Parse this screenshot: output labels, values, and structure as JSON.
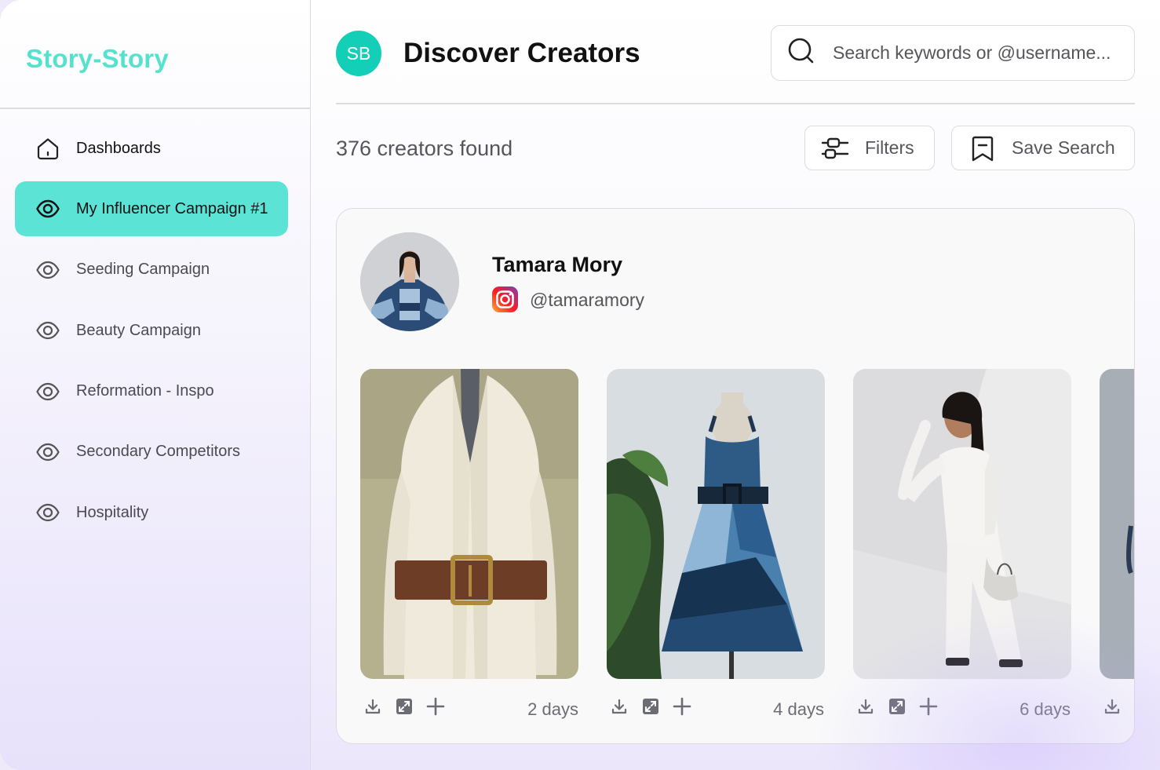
{
  "sidebar": {
    "logo": "Story-Story",
    "items": [
      {
        "label": "Dashboards",
        "icon": "home-icon"
      },
      {
        "label": "My Influencer Campaign #1",
        "icon": "eye-icon",
        "active": true
      },
      {
        "label": "Seeding Campaign",
        "icon": "eye-icon"
      },
      {
        "label": "Beauty Campaign",
        "icon": "eye-icon"
      },
      {
        "label": "Reformation - Inspo",
        "icon": "eye-icon"
      },
      {
        "label": "Secondary Competitors",
        "icon": "eye-icon"
      },
      {
        "label": "Hospitality",
        "icon": "eye-icon"
      }
    ]
  },
  "header": {
    "avatar_initials": "SB",
    "title": "Discover Creators",
    "search_placeholder": "Search keywords or @username..."
  },
  "toolbar": {
    "count_text": "376 creators found",
    "filters_label": "Filters",
    "save_search_label": "Save Search"
  },
  "creator": {
    "name": "Tamara Mory",
    "handle": "@tamaramory",
    "platform_icon": "instagram-icon",
    "posts": [
      {
        "age": "2 days",
        "subject": "cream blazer dress with brown belt on mannequin"
      },
      {
        "age": "4 days",
        "subject": "patchwork denim dress on mannequin"
      },
      {
        "age": "6 days",
        "subject": "woman in white outfit with handbag"
      },
      {
        "age": "",
        "subject": "partially visible post"
      }
    ]
  },
  "colors": {
    "accent": "#5be3d6",
    "logo": "#54e2cf",
    "avatar": "#14cfb7"
  }
}
